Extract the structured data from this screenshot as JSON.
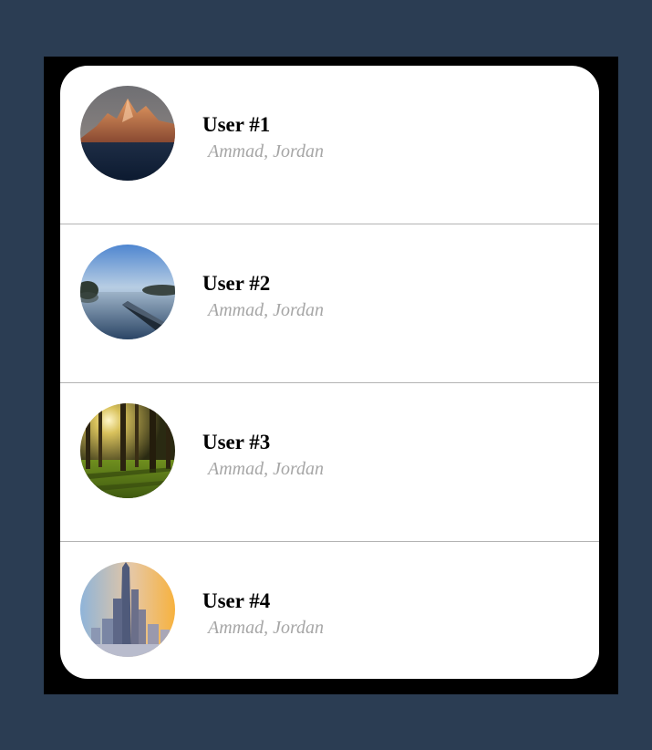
{
  "colors": {
    "page_background": "#2b3d53",
    "frame": "#000000",
    "card": "#ffffff",
    "divider": "#b3b3b3",
    "name_text": "#000000",
    "location_text": "#a6a6a6"
  },
  "users": [
    {
      "name": "User #1",
      "location": "Ammad, Jordan",
      "avatar": "mountain-peak-photo"
    },
    {
      "name": "User #2",
      "location": "Ammad, Jordan",
      "avatar": "lake-pier-photo"
    },
    {
      "name": "User #3",
      "location": "Ammad, Jordan",
      "avatar": "sunlit-forest-photo"
    },
    {
      "name": "User #4",
      "location": "Ammad, Jordan",
      "avatar": "city-skyline-photo"
    }
  ]
}
